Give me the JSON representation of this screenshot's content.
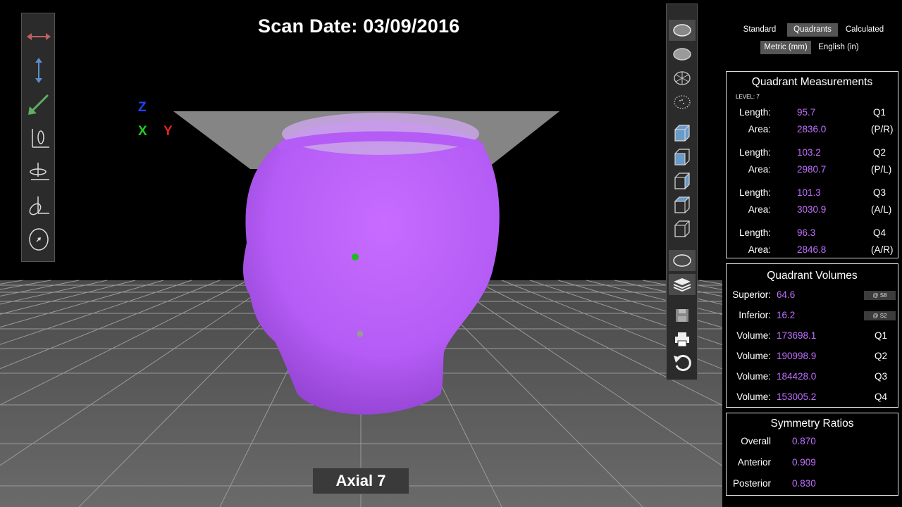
{
  "scan_date": "Scan Date: 03/09/2016",
  "axes": {
    "z": "Z",
    "x": "X",
    "y": "Y"
  },
  "axial_label": "Axial 7",
  "colors": {
    "accent_value": "#c070ff",
    "head_fill": "#b45cf5",
    "axis_x": "#22cc22",
    "axis_y": "#dd2222",
    "axis_z": "#2244ff"
  },
  "left_toolbar": [
    {
      "name": "width-arrow-icon"
    },
    {
      "name": "height-arrow-icon"
    },
    {
      "name": "diagonal-arrow-icon"
    },
    {
      "name": "rotate-x-icon"
    },
    {
      "name": "rotate-y-icon"
    },
    {
      "name": "rotate-z-icon"
    },
    {
      "name": "head-top-icon"
    }
  ],
  "right_toolbar": [
    {
      "name": "shaded-head-icon"
    },
    {
      "name": "smooth-head-icon"
    },
    {
      "name": "mesh-head-icon"
    },
    {
      "name": "points-head-icon"
    },
    {
      "name": "cube-solid-icon"
    },
    {
      "name": "cube-front-icon"
    },
    {
      "name": "cube-side-icon"
    },
    {
      "name": "cube-top-icon"
    },
    {
      "name": "cube-wire-icon"
    },
    {
      "name": "contour-icon"
    },
    {
      "name": "layers-icon"
    },
    {
      "name": "save-icon"
    },
    {
      "name": "print-icon"
    },
    {
      "name": "reset-icon"
    }
  ],
  "view_modes": [
    "Standard",
    "Quadrants",
    "Calculated"
  ],
  "active_view_mode": "Quadrants",
  "units": [
    "Metric (mm)",
    "English (in)"
  ],
  "active_unit": "Metric (mm)",
  "quadrant_measurements": {
    "title": "Quadrant Measurements",
    "level": "LEVEL: 7",
    "groups": [
      {
        "length_label": "Length:",
        "length": "95.7",
        "quadrant": "Q1",
        "area_label": "Area:",
        "area": "2836.0",
        "region": "(P/R)"
      },
      {
        "length_label": "Length:",
        "length": "103.2",
        "quadrant": "Q2",
        "area_label": "Area:",
        "area": "2980.7",
        "region": "(P/L)"
      },
      {
        "length_label": "Length:",
        "length": "101.3",
        "quadrant": "Q3",
        "area_label": "Area:",
        "area": "3030.9",
        "region": "(A/L)"
      },
      {
        "length_label": "Length:",
        "length": "96.3",
        "quadrant": "Q4",
        "area_label": "Area:",
        "area": "2846.8",
        "region": "(A/R)"
      }
    ]
  },
  "quadrant_volumes": {
    "title": "Quadrant Volumes",
    "rows": [
      {
        "label": "Superior:",
        "value": "64.6",
        "tag": "",
        "chip": "@ S8"
      },
      {
        "label": "Inferior:",
        "value": "16.2",
        "tag": "",
        "chip": "@ S2"
      },
      {
        "label": "Volume:",
        "value": "173698.1",
        "tag": "Q1",
        "chip": ""
      },
      {
        "label": "Volume:",
        "value": "190998.9",
        "tag": "Q2",
        "chip": ""
      },
      {
        "label": "Volume:",
        "value": "184428.0",
        "tag": "Q3",
        "chip": ""
      },
      {
        "label": "Volume:",
        "value": "153005.2",
        "tag": "Q4",
        "chip": ""
      }
    ]
  },
  "symmetry_ratios": {
    "title": "Symmetry Ratios",
    "rows": [
      {
        "label": "Overall",
        "value": "0.870"
      },
      {
        "label": "Anterior",
        "value": "0.909"
      },
      {
        "label": "Posterior",
        "value": "0.830"
      }
    ]
  }
}
